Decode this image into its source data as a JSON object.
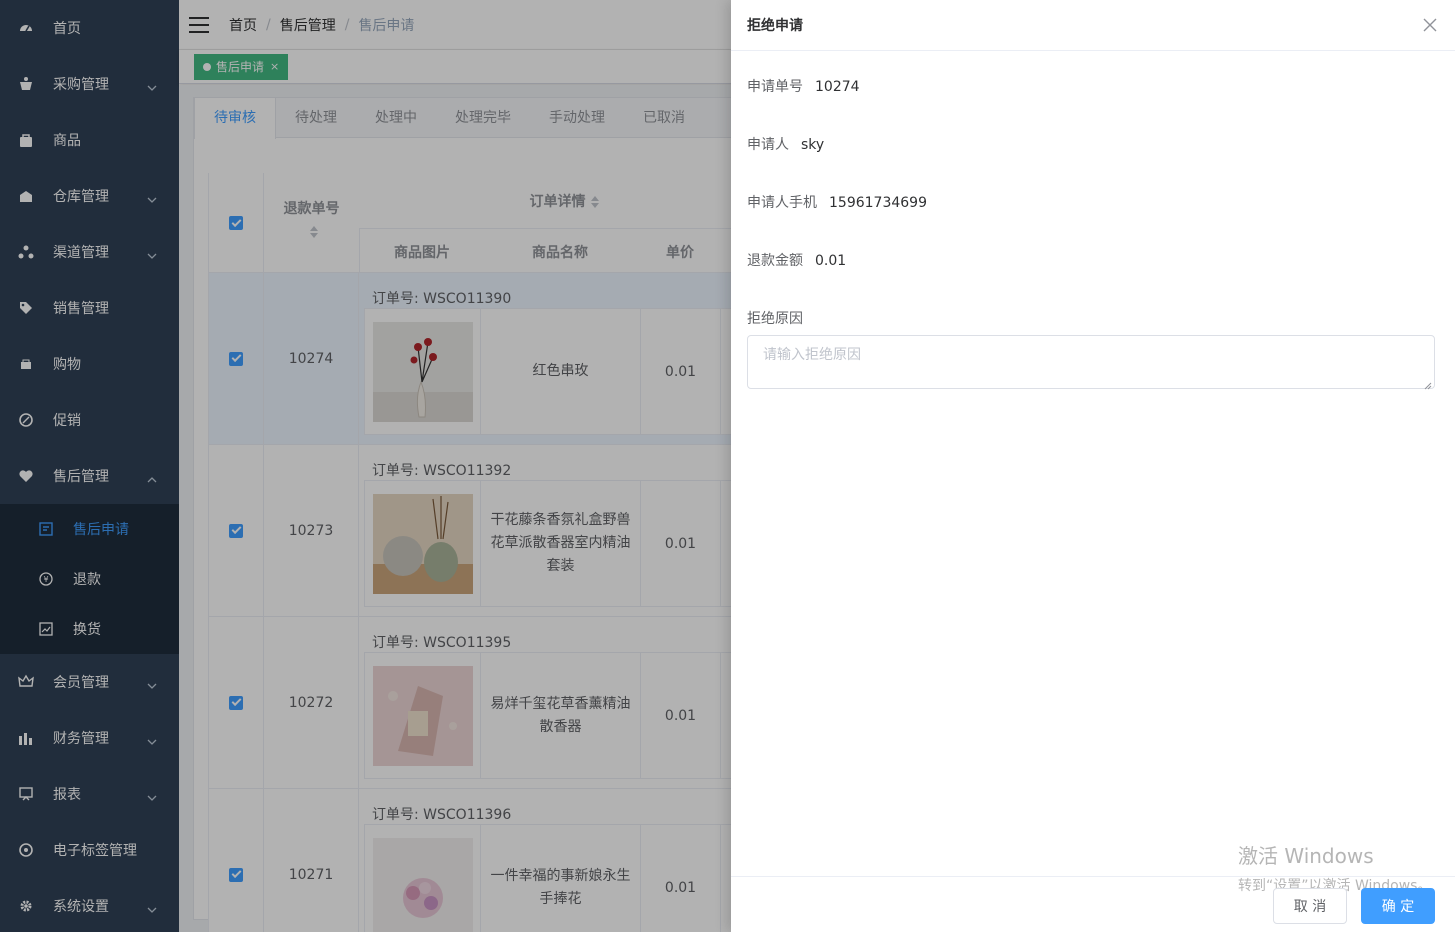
{
  "sidebar": {
    "items": [
      {
        "label": "首页",
        "icon": "dashboard-icon"
      },
      {
        "label": "采购管理",
        "icon": "purchase-icon"
      },
      {
        "label": "商品",
        "icon": "bag-icon"
      },
      {
        "label": "仓库管理",
        "icon": "warehouse-icon"
      },
      {
        "label": "渠道管理",
        "icon": "channel-icon"
      },
      {
        "label": "销售管理",
        "icon": "tag-icon"
      },
      {
        "label": "购物",
        "icon": "shopping-icon"
      },
      {
        "label": "促销",
        "icon": "promotion-icon"
      },
      {
        "label": "售后管理",
        "icon": "aftersale-icon"
      }
    ],
    "sub_items": [
      {
        "label": "售后申请",
        "icon": "apply-icon"
      },
      {
        "label": "退款",
        "icon": "refund-icon"
      },
      {
        "label": "换货",
        "icon": "exchange-icon"
      }
    ],
    "bottom_items": [
      {
        "label": "会员管理",
        "icon": "crown-icon"
      },
      {
        "label": "财务管理",
        "icon": "finance-icon"
      },
      {
        "label": "报表",
        "icon": "report-icon"
      },
      {
        "label": "电子标签管理",
        "icon": "label-icon"
      },
      {
        "label": "系统设置",
        "icon": "gear-icon"
      }
    ]
  },
  "breadcrumb": [
    "首页",
    "售后管理",
    "售后申请"
  ],
  "tagsview": {
    "label": "售后申请"
  },
  "tabs": [
    "待审核",
    "待处理",
    "处理中",
    "处理完毕",
    "手动处理",
    "已取消"
  ],
  "table": {
    "headers": {
      "refund_no": "退款单号",
      "order_detail": "订单详情",
      "image": "商品图片",
      "name": "商品名称",
      "price": "单价"
    },
    "order_prefix": "订单号: ",
    "rows": [
      {
        "id": "10274",
        "order": "订单号: WSCO11390",
        "name": "红色串玫",
        "price": "0.01"
      },
      {
        "id": "10273",
        "order": "订单号: WSCO11392",
        "name": "干花藤条香氛礼盒野兽花草派散香器室内精油套装",
        "price": "0.01"
      },
      {
        "id": "10272",
        "order": "订单号: WSCO11395",
        "name": "易烊千玺花草香薰精油散香器",
        "price": "0.01"
      },
      {
        "id": "10271",
        "order": "订单号: WSCO11396",
        "name": "一件幸福的事新娘永生手捧花",
        "price": "0.01"
      }
    ]
  },
  "drawer": {
    "title": "拒绝申请",
    "fields": [
      {
        "label": "申请单号",
        "value": "10274"
      },
      {
        "label": "申请人",
        "value": "sky"
      },
      {
        "label": "申请人手机",
        "value": "15961734699"
      },
      {
        "label": "退款金额",
        "value": "0.01"
      }
    ],
    "reason_label": "拒绝原因",
    "reason_placeholder": "请输入拒绝原因",
    "cancel_label": "取 消",
    "confirm_label": "确 定"
  },
  "watermark": {
    "line1": "激活 Windows",
    "line2": "转到“设置”以激活 Windows。"
  },
  "colors": {
    "sidebar_bg": "#304156",
    "submenu_bg": "#1f2d3d",
    "primary": "#409eff",
    "tag": "#42b983"
  }
}
